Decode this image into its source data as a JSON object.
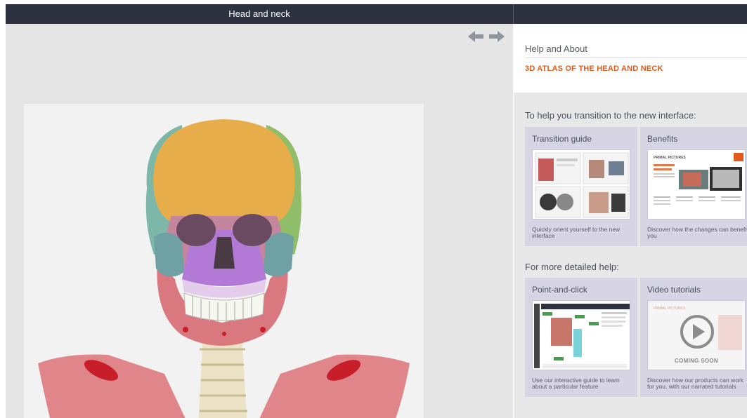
{
  "header": {
    "title": "Head and neck"
  },
  "viewer": {
    "nav_icon": "left-right-arrows-icon"
  },
  "sidebar": {
    "help_label": "Help and About",
    "product_title": "3D ATLAS OF THE HEAD AND NECK",
    "transition_heading": "To help you transition to the new interface:",
    "detailed_heading": "For more detailed help:",
    "cards": [
      {
        "title": "Transition guide",
        "description": "Quickly orient yourself to the new interface"
      },
      {
        "title": "Benefits",
        "description": "Discover how the changes can benefit you",
        "thumb_heading": "PRIMAL PICTURES"
      },
      {
        "title": "Point-and-click",
        "description": "Use our interactive guide to learn about a particular feature"
      },
      {
        "title": "Video tutorials",
        "description": "Discover how our products can work for you, with our narrated tutorials",
        "thumb_heading": "PRIMAL PICTURES",
        "badge": "COMING SOON"
      }
    ]
  },
  "colors": {
    "header_bg": "#2e3240",
    "accent": "#e05a1c",
    "card_bg": "#d7d5e3"
  }
}
